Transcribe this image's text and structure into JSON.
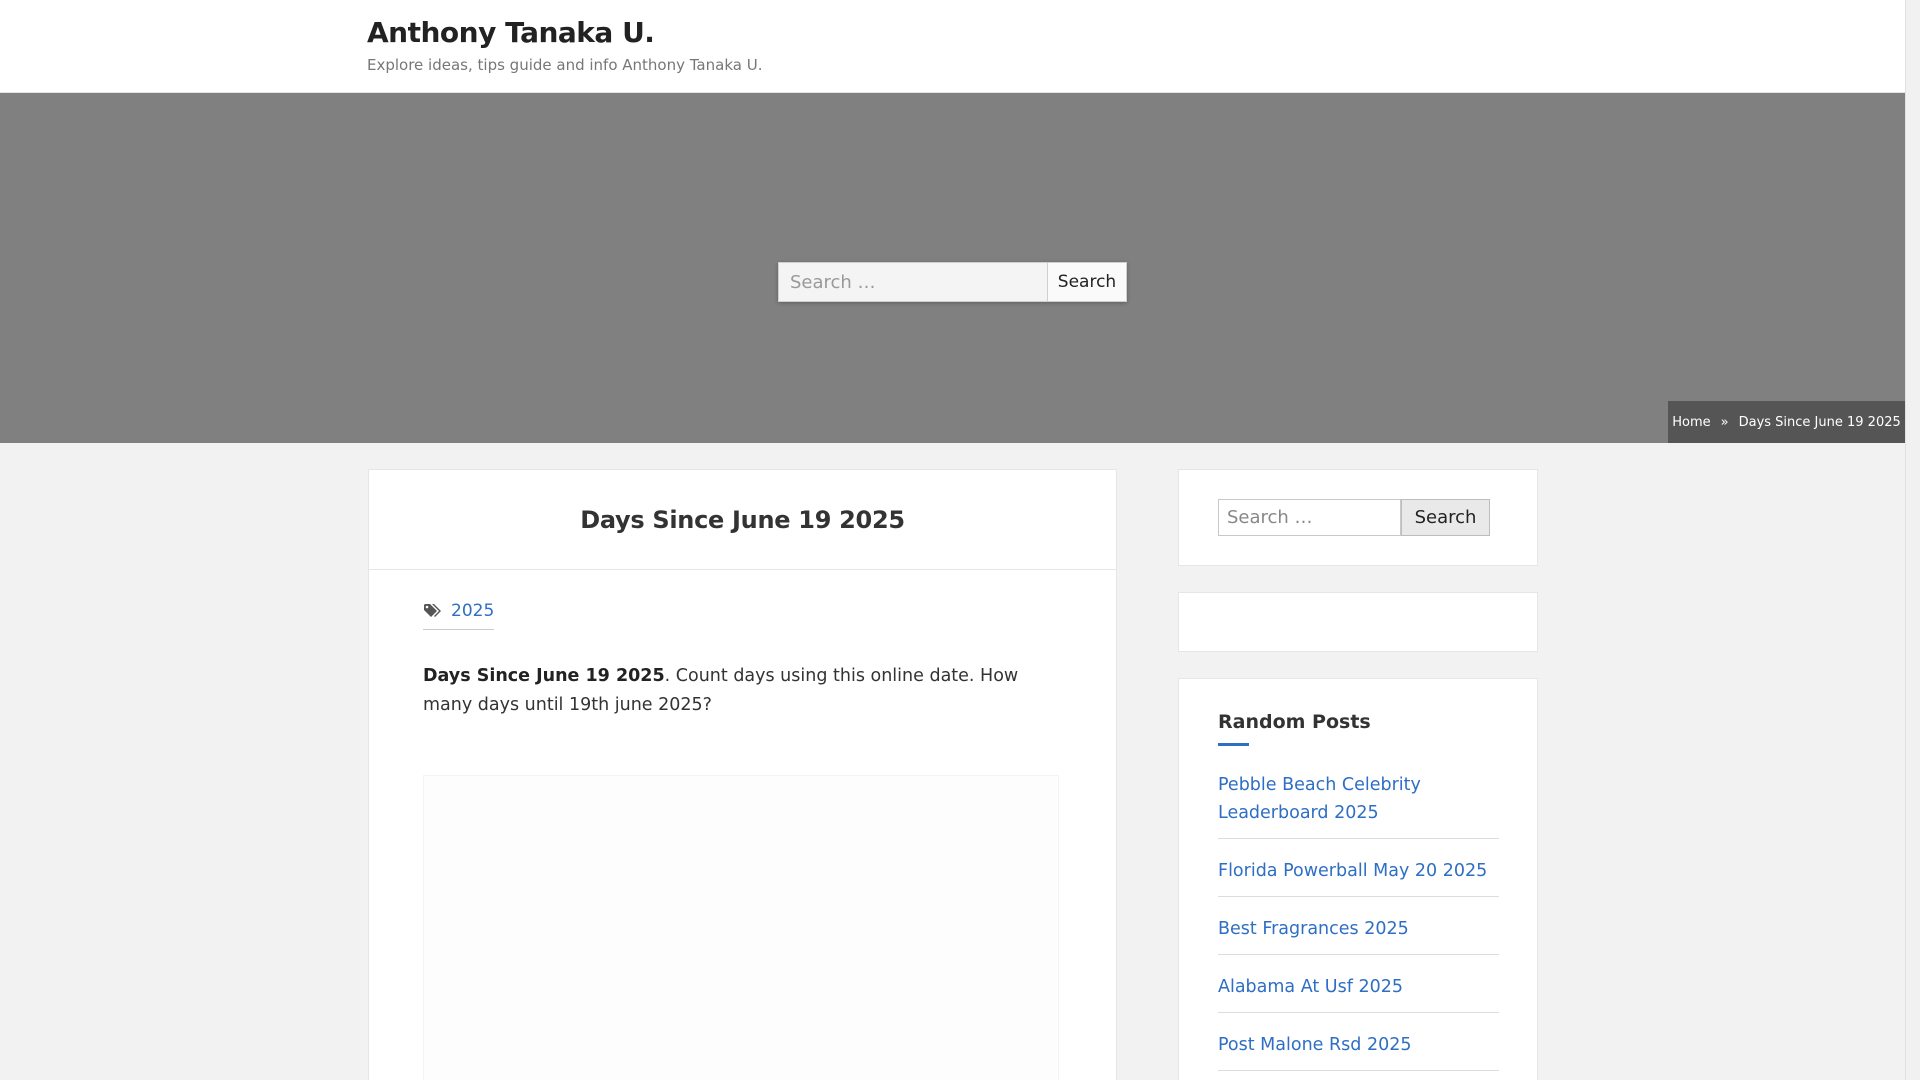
{
  "header": {
    "title": "Anthony Tanaka U.",
    "description": "Explore ideas, tips guide and info Anthony Tanaka U."
  },
  "hero": {
    "search_placeholder": "Search …",
    "search_button": "Search"
  },
  "breadcrumbs": {
    "home": "Home",
    "separator": "»",
    "current": "Days Since June 19 2025"
  },
  "article": {
    "title": "Days Since June 19 2025",
    "tag": "2025",
    "tag_icon": "tags-icon",
    "body_bold": "Days Since June 19 2025",
    "body_rest": ". Count days using this online date. How many days until 19th june 2025?"
  },
  "sidebar": {
    "search_placeholder": "Search …",
    "search_button": "Search",
    "random_title": "Random Posts",
    "posts": [
      "Pebble Beach Celebrity Leaderboard 2025",
      "Florida Powerball May 20 2025",
      "Best Fragrances 2025",
      "Alabama At Usf 2025",
      "Post Malone Rsd 2025"
    ]
  },
  "colors": {
    "accent": "#2e6ec4",
    "hero_bg": "#808080",
    "breadcrumb_bg": "#555555"
  }
}
